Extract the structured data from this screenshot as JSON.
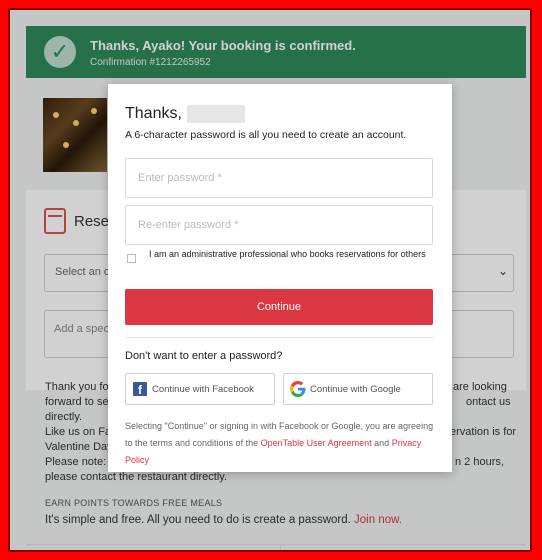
{
  "banner": {
    "title": "Thanks, Ayako! Your booking is confirmed.",
    "confirmation": "Confirmation #1212265952"
  },
  "reservation": {
    "heading": "Rese",
    "select_label": "Select an o",
    "special_placeholder": "Add a spec"
  },
  "bg_text": {
    "line1_left": "Thank you fo",
    "line1_right": "are looking",
    "line2_left": "forward to se",
    "line2_right": "ontact us",
    "line3": "directly.",
    "line4_left": "Like us on Fac",
    "line4_right": "ervation is for",
    "line5": "Valentine Day",
    "line6_left": "Please note: y",
    "line6_right": "n 2 hours,",
    "line7": "please contact the restaurant directly."
  },
  "earn": {
    "heading": "EARN POINTS TOWARDS FREE MEALS",
    "text": "It's simple and free. All you need to do is create a password. ",
    "join": "Join now."
  },
  "modal": {
    "title": "Thanks,",
    "subtitle": "A 6-character password is all you need to create an account.",
    "password_placeholder": "Enter password *",
    "reenter_placeholder": "Re-enter password *",
    "checkbox_label": "I am an administrative professional who books reservations for others",
    "continue_label": "Continue",
    "no_password": "Don't want to enter a password?",
    "facebook_label": "Continue with Facebook",
    "google_label": "Continue with Google",
    "terms_prefix": "Selecting \"Continue\" or signing in with Facebook or Google, you are agreeing to the terms and conditions of the ",
    "terms_link": "OpenTable User Agreement",
    "terms_and": " and ",
    "privacy_link": "Privacy Policy"
  },
  "colors": {
    "frame": "#ff0000",
    "banner": "#2f8a5a",
    "accent": "#da3743",
    "facebook": "#3b5998"
  },
  "icons": {
    "check": "check-icon",
    "calendar": "calendar-icon",
    "chevron": "chevron-down-icon",
    "facebook": "facebook-icon",
    "google": "google-icon"
  }
}
